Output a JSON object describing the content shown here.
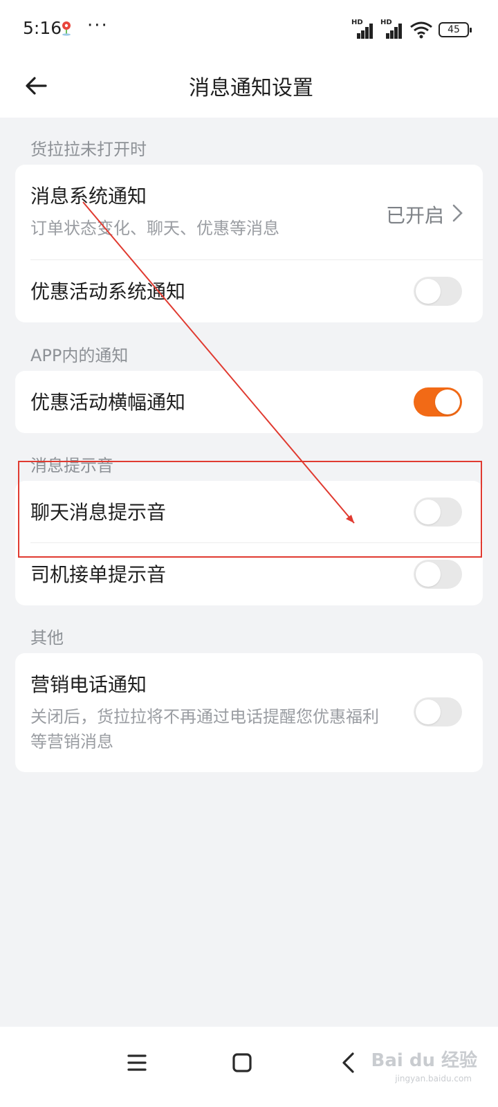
{
  "status_bar": {
    "time": "5:16",
    "dots": "···",
    "signal1_label": "HD",
    "signal2_label": "HD",
    "battery": "45"
  },
  "header": {
    "title": "消息通知设置",
    "back_icon": "arrow-left-icon"
  },
  "sections": [
    {
      "label": "货拉拉未打开时",
      "rows": [
        {
          "title": "消息系统通知",
          "subtitle": "订单状态变化、聊天、优惠等消息",
          "value": "已开启"
        },
        {
          "title": "优惠活动系统通知",
          "toggle": false
        }
      ]
    },
    {
      "label": "APP内的通知",
      "rows": [
        {
          "title": "优惠活动横幅通知",
          "toggle": true
        }
      ]
    },
    {
      "label": "消息提示音",
      "rows": [
        {
          "title": "聊天消息提示音",
          "toggle": false
        },
        {
          "title": "司机接单提示音",
          "toggle": false
        }
      ]
    },
    {
      "label": "其他",
      "rows": [
        {
          "title": "营销电话通知",
          "subtitle": "关闭后，货拉拉将不再通过电话提醒您优惠福利等营销消息",
          "toggle": false
        }
      ]
    }
  ],
  "colors": {
    "accent": "#f26a16",
    "annotation": "#e03a30",
    "background": "#f2f3f5"
  },
  "watermark": {
    "brand": "Bai du 经验",
    "url": "jingyan.baidu.com"
  }
}
